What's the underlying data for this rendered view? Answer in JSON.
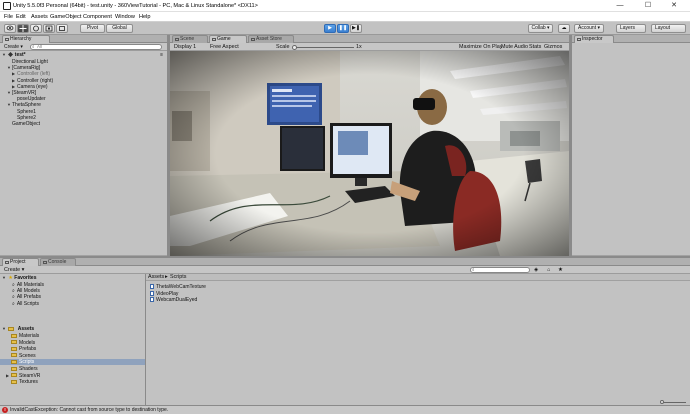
{
  "window": {
    "title": "Unity 5.5.0f3 Personal (64bit) - test.unity - 360ViewTutorial - PC, Mac & Linux Standalone* <DX11>",
    "minimize": "—",
    "maximize": "☐",
    "close": "✕"
  },
  "menu": [
    "File",
    "Edit",
    "Assets",
    "GameObject",
    "Component",
    "Window",
    "Help"
  ],
  "toolbar": {
    "pivot": "Pivot",
    "global": "Global",
    "play": "▶",
    "pause": "❚❚",
    "step": "▶❚",
    "collab": "Collab ▾",
    "cloud": "☁",
    "account": "Account ▾",
    "layers": "Layers",
    "layout": "Layout"
  },
  "hierarchy": {
    "tab": "Hierarchy",
    "create": "Create ▾",
    "search_placeholder": "All",
    "scene": "test*",
    "items": [
      {
        "label": "Directional Light",
        "depth": 1,
        "arrow": ""
      },
      {
        "label": "[CameraRig]",
        "depth": 1,
        "arrow": "▼"
      },
      {
        "label": "Controller (left)",
        "depth": 2,
        "arrow": "▶",
        "muted": true
      },
      {
        "label": "Controller (right)",
        "depth": 2,
        "arrow": "▶"
      },
      {
        "label": "Camera (eye)",
        "depth": 2,
        "arrow": "▶"
      },
      {
        "label": "[SteamVR]",
        "depth": 1,
        "arrow": "▼"
      },
      {
        "label": "poseUpdater",
        "depth": 2,
        "arrow": ""
      },
      {
        "label": "ThetaSphere",
        "depth": 1,
        "arrow": "▼"
      },
      {
        "label": "Sphere1",
        "depth": 2,
        "arrow": ""
      },
      {
        "label": "Sphere2",
        "depth": 2,
        "arrow": ""
      },
      {
        "label": "GameObject",
        "depth": 1,
        "arrow": ""
      }
    ]
  },
  "center_tabs": {
    "scene": "Scene",
    "game": "Game",
    "asset_store": "Asset Store"
  },
  "game_toolbar": {
    "display": "Display 1",
    "aspect": "Free Aspect",
    "scale_label": "Scale",
    "scale_value": "1x",
    "maximize_on_play": "Maximize On Play",
    "mute_audio": "Mute Audio",
    "stats": "Stats",
    "gizmos": "Gizmos"
  },
  "inspector": {
    "tab": "Inspector"
  },
  "project": {
    "tab_project": "Project",
    "tab_console": "Console",
    "create": "Create ▾",
    "favorites_label": "Favorites",
    "favorites": [
      "All Materials",
      "All Models",
      "All Prefabs",
      "All Scripts"
    ],
    "assets_label": "Assets",
    "folders": [
      {
        "label": "Materials",
        "arrow": ""
      },
      {
        "label": "Models",
        "arrow": ""
      },
      {
        "label": "Prefabs",
        "arrow": ""
      },
      {
        "label": "Scenes",
        "arrow": ""
      },
      {
        "label": "Scripts",
        "arrow": "",
        "selected": true
      },
      {
        "label": "Shaders",
        "arrow": ""
      },
      {
        "label": "SteamVR",
        "arrow": "▶"
      },
      {
        "label": "Textures",
        "arrow": ""
      }
    ],
    "breadcrumb_root": "Assets",
    "breadcrumb_sep": "▸",
    "breadcrumb_current": "Scripts",
    "files": [
      "ThetaWebCamTexture",
      "VideoPlay",
      "WebcamDualEyed"
    ]
  },
  "status": {
    "message": "InvalidCastException: Cannot cast from source type to destination type."
  },
  "colors": {
    "error": "#c62020",
    "accent": "#3b7fd0"
  }
}
